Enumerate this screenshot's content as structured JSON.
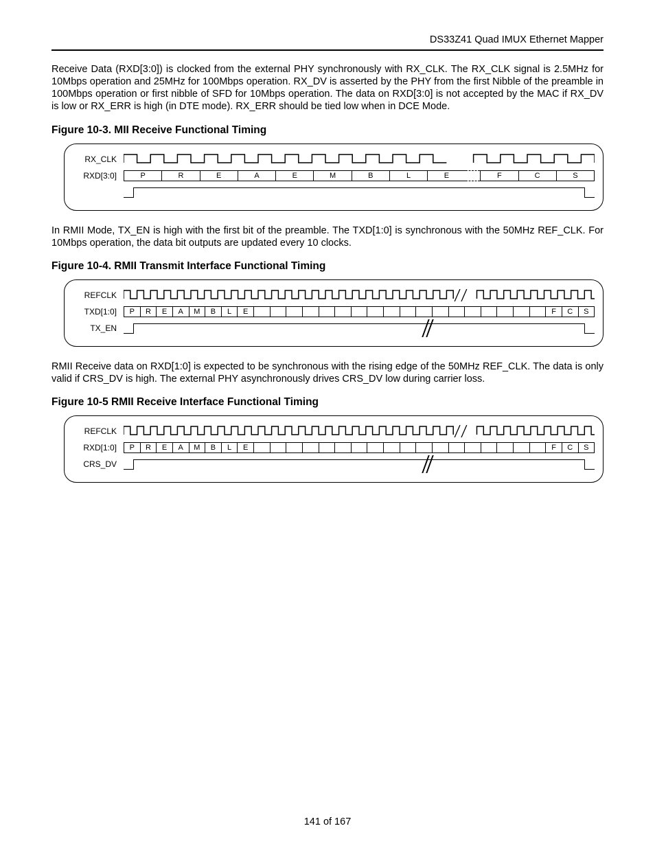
{
  "header": {
    "product": "DS33Z41 Quad IMUX Ethernet Mapper"
  },
  "paragraphs": {
    "p1": "Receive Data (RXD[3:0]) is clocked from the external PHY synchronously with RX_CLK. The RX_CLK signal is 2.5MHz for 10Mbps operation and 25MHz for 100Mbps operation. RX_DV is asserted by the PHY from the first Nibble of the preamble in 100Mbps operation or first nibble of SFD for 10Mbps operation. The data on RXD[3:0] is not accepted by the MAC if RX_DV is low or RX_ERR is high (in DTE mode). RX_ERR should be tied low when in DCE Mode.",
    "p2": "In RMII Mode, TX_EN is high with the first bit of the preamble. The TXD[1:0] is synchronous with the 50MHz REF_CLK. For 10Mbps operation, the data bit outputs are updated every 10 clocks.",
    "p3": "RMII Receive data on RXD[1:0] is expected to be synchronous with the rising edge of the 50MHz REF_CLK. The data is only valid if CRS_DV is high. The external PHY asynchronously drives CRS_DV low during carrier loss."
  },
  "figures": {
    "f103": {
      "title": "Figure 10-3. MII Receive Functional Timing",
      "signals": {
        "clk": "RX_CLK",
        "data": "RXD[3:0]",
        "en": ""
      },
      "data_cells": [
        "P",
        "R",
        "E",
        "A",
        "E",
        "M",
        "B",
        "L",
        "E",
        "…",
        "F",
        "C",
        "S"
      ]
    },
    "f104": {
      "title": "Figure 10-4. RMII Transmit Interface Functional Timing",
      "signals": {
        "clk": "REFCLK",
        "data": "TXD[1:0]",
        "en": "TX_EN"
      },
      "data_cells": [
        "P",
        "R",
        "E",
        "A",
        "M",
        "B",
        "L",
        "E",
        "",
        "",
        "",
        "",
        "",
        "",
        "",
        "",
        "",
        "",
        "",
        "",
        "",
        "",
        "",
        "",
        "",
        "",
        "F",
        "C",
        "S"
      ]
    },
    "f105": {
      "title": "Figure 10-5 RMII Receive Interface Functional Timing",
      "signals": {
        "clk": "REFCLK",
        "data": "RXD[1:0]",
        "en": "CRS_DV"
      },
      "data_cells": [
        "P",
        "R",
        "E",
        "A",
        "M",
        "B",
        "L",
        "E",
        "",
        "",
        "",
        "",
        "",
        "",
        "",
        "",
        "",
        "",
        "",
        "",
        "",
        "",
        "",
        "",
        "",
        "",
        "F",
        "C",
        "S"
      ]
    }
  },
  "footer": {
    "page": "141 of 167"
  }
}
